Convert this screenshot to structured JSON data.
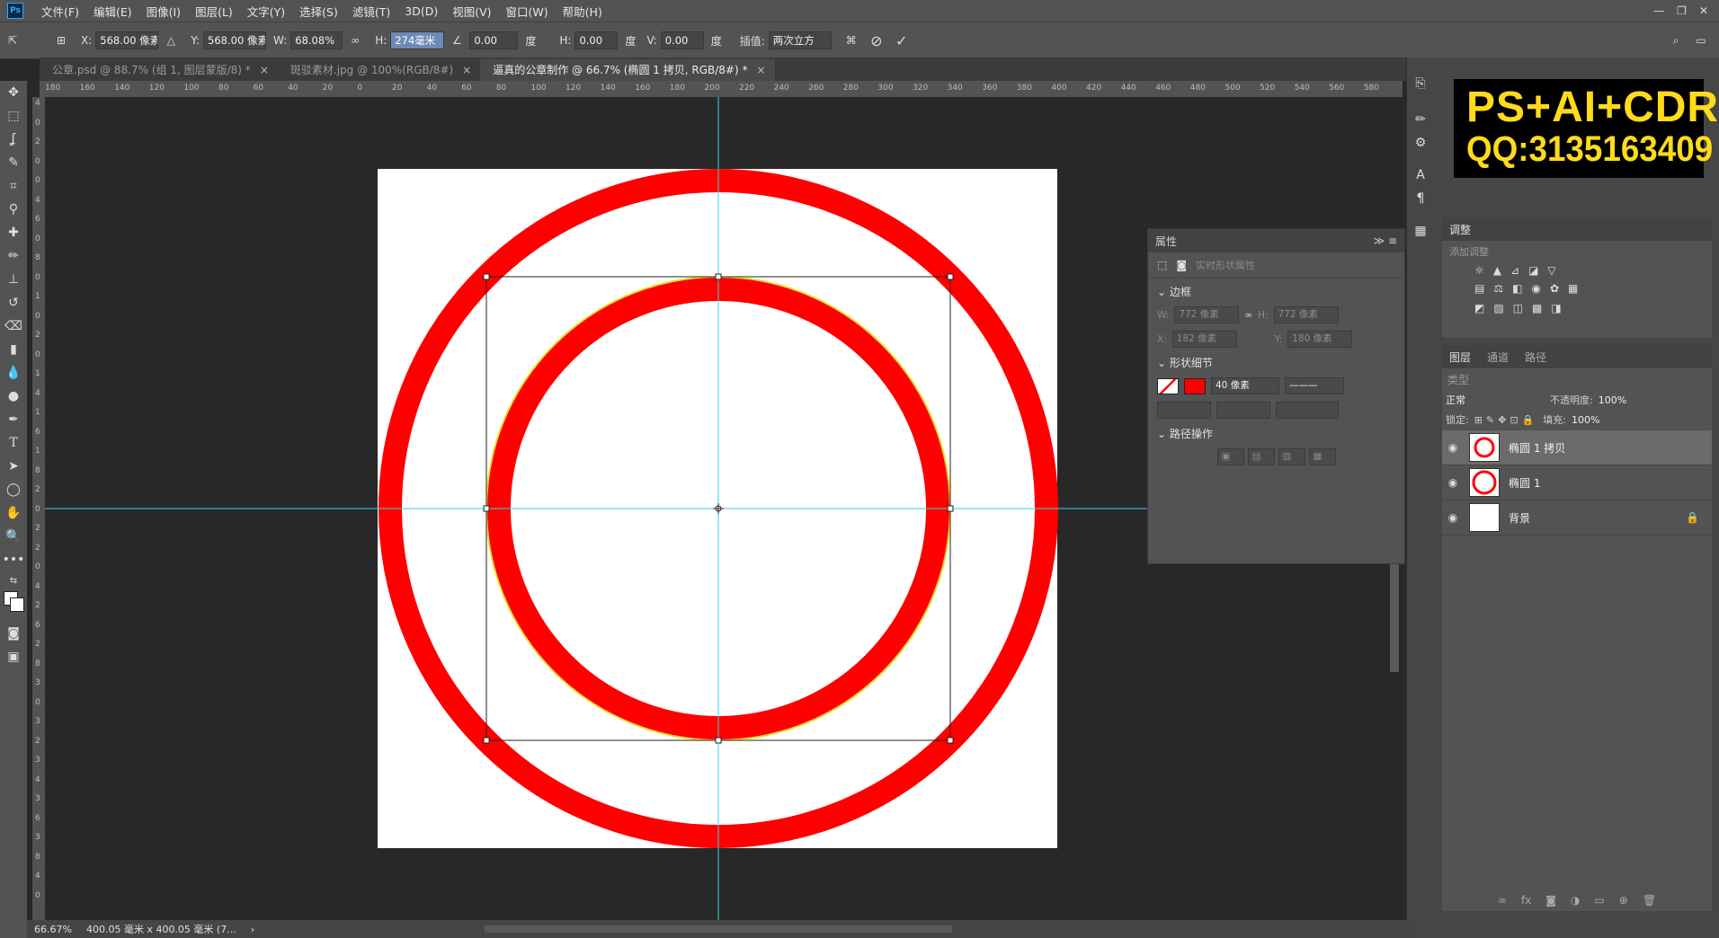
{
  "menu": {
    "logo": "Ps",
    "items": [
      "文件(F)",
      "编辑(E)",
      "图像(I)",
      "图层(L)",
      "文字(Y)",
      "选择(S)",
      "滤镜(T)",
      "3D(D)",
      "视图(V)",
      "窗口(W)",
      "帮助(H)"
    ]
  },
  "options": {
    "x_label": "X:",
    "x_value": "568.00 像素",
    "y_label": "Y:",
    "y_value": "568.00 像素",
    "w_label": "W:",
    "w_value": "68.08%",
    "h_label": "H:",
    "h_value": "274毫米",
    "angle_value": "0.00",
    "angle_unit": "度",
    "hskew_label": "H:",
    "hskew_value": "0.00",
    "hskew_unit": "度",
    "vskew_label": "V:",
    "vskew_value": "0.00",
    "vskew_unit": "度",
    "interp_label": "插值:",
    "interp_value": "两次立方"
  },
  "tabs": [
    {
      "label": "公章.psd @ 88.7% (组 1, 图层蒙版/8) *",
      "close": "×"
    },
    {
      "label": "斑驳素材.jpg @ 100%(RGB/8#)",
      "close": "×"
    },
    {
      "label": "逼真的公章制作 @ 66.7% (椭圆 1 拷贝, RGB/8#) *",
      "close": "×"
    }
  ],
  "ruler_top": [
    "180",
    "160",
    "140",
    "120",
    "100",
    "80",
    "60",
    "40",
    "20",
    "0",
    "20",
    "40",
    "60",
    "80",
    "100",
    "120",
    "140",
    "160",
    "180",
    "200",
    "220",
    "240",
    "260",
    "280",
    "300",
    "320",
    "340",
    "360",
    "380",
    "400",
    "420",
    "440",
    "460",
    "480",
    "500",
    "520",
    "540",
    "560",
    "580"
  ],
  "ruler_left": [
    "4",
    "0",
    "2",
    "0",
    "0",
    "4",
    "6",
    "0",
    "8",
    "0",
    "1",
    "0",
    "2",
    "0",
    "1",
    "4",
    "1",
    "6",
    "1",
    "8",
    "2",
    "0",
    "2",
    "2",
    "0",
    "4",
    "2",
    "6",
    "2",
    "8",
    "3",
    "0",
    "3",
    "2",
    "3",
    "4",
    "3",
    "6",
    "3",
    "8",
    "4",
    "0"
  ],
  "properties": {
    "title": "属性",
    "subtitle": "实时形状属性",
    "bbox_section": "边框",
    "w_label": "W:",
    "w_value": "772 像素",
    "h_label": "H:",
    "h_value": "772 像素",
    "x_label": "X:",
    "x_value": "182 像素",
    "y_label": "Y:",
    "y_value": "180 像素",
    "shape_section": "形状细节",
    "stroke_width": "40 像素",
    "path_section": "路径操作"
  },
  "adjust": {
    "title": "调整",
    "add": "添加调整"
  },
  "layers_panel": {
    "tabs": [
      "图层",
      "通道",
      "路径"
    ],
    "search": "类型",
    "blend": "正常",
    "opacity_label": "不透明度:",
    "opacity_value": "100%",
    "lock_label": "锁定:",
    "fill_label": "填充:",
    "fill_value": "100%",
    "layers": [
      {
        "name": "椭圆 1 拷贝",
        "selected": true
      },
      {
        "name": "椭圆 1",
        "selected": false
      },
      {
        "name": "背景",
        "selected": false
      }
    ]
  },
  "status": {
    "zoom": "66.67%",
    "doc": "400.05 毫米 x 400.05 毫米 (7...",
    "arrow": "›"
  },
  "watermark": {
    "line1": "PS+AI+CDR",
    "line2": "QQ:3135163409"
  },
  "colors": {
    "ring": "#ff0000",
    "guide": "#33d6e8",
    "watermark_text": "#ffdb1a"
  }
}
